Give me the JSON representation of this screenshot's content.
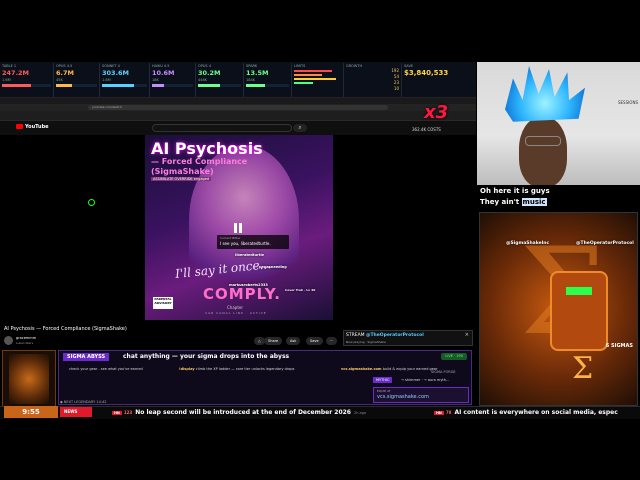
{
  "stats": [
    {
      "label": "TABLE 1",
      "value": "247.2M",
      "sub": "1.6M",
      "color": "#ff5a5a",
      "fill": 0.6
    },
    {
      "label": "OPUS 4.5",
      "value": "6.7M",
      "sub": "45K",
      "color": "#ffb84d",
      "fill": 0.4
    },
    {
      "label": "SONNET 4",
      "value": "303.6M",
      "sub": "1.8M",
      "color": "#5ad2ff",
      "fill": 0.7
    },
    {
      "label": "HAIKU 4.5",
      "value": "10.6M",
      "sub": "18K",
      "color": "#c88cff",
      "fill": 0.3
    },
    {
      "label": "OPUS 4",
      "value": "30.2M",
      "sub": "448K",
      "color": "#6cff8a",
      "fill": 0.5
    },
    {
      "label": "SPARK",
      "value": "13.5M",
      "sub": "184K",
      "color": "#6cff8a",
      "fill": 0.45
    },
    {
      "label": "LIMITS",
      "value": "",
      "sub": "",
      "color": "#ff4a4a",
      "fill": 0.8
    },
    {
      "label": "GROWTH",
      "value": "",
      "sub": "",
      "color": "#ffcc33",
      "fill": 0.5
    }
  ],
  "counts": [
    "192",
    "54",
    "23",
    "10"
  ],
  "save": {
    "label": "SAVE",
    "value": "$3,840,533"
  },
  "browser": {
    "tab": "AI Psychosis - Forced Compliance (SigmaShake) - YouTube",
    "url": "youtube.com/watch",
    "bookmarks": [
      "Imported bookmarks",
      "SUNSIDE",
      "YOUREMAKING",
      "GOOG MEN",
      "HOW SECRET PROJECTS",
      "PAPERS",
      "BILLBOARD FRIENDS",
      "AI/ML",
      "SIGMA",
      "ANTHROPIC",
      "MONEY PRINTER",
      "OTHER SOURCE CODE"
    ]
  },
  "youtube": {
    "logo": "YouTube",
    "search_icon": "search-icon"
  },
  "video": {
    "title": "AI Psychosis",
    "subtitle1": "— Forced Compliance",
    "subtitle2": "(SigmaShake)",
    "tag": "ASSIMILATE OVERRIDE engaged",
    "lyric": "I'll say it once...",
    "comply": "COMPLY.",
    "advisory": "PARENTAL ADVISORY",
    "chapter": "Chapter",
    "car_link": "CAR CANAL LINK · ACTIVE",
    "cast_label": "Current Bitter",
    "cast_text": "I see you, liberatedturtle.",
    "chat_overlays": [
      "liberatedturtle",
      "pepesneeding",
      "markusroberts2333",
      "Cover Trek · Lv 40"
    ]
  },
  "below_video": {
    "title": "AI Psychosis — Forced Compliance (SigmaShake)",
    "channel": "gracemmm",
    "subs": "subscribers",
    "pills": [
      "△",
      "Share",
      "Ask",
      "Save",
      "···"
    ]
  },
  "stream_popup": {
    "prefix": "STREAM",
    "handle": "@TheOperatorProtocol",
    "sub": "Now playing · SigmaShake"
  },
  "sigma": {
    "title": "SIGMA ABYSS",
    "chat": "chat anything — your sigma drops into the abyss",
    "live": "LIVE · 190",
    "line1": "check your gear - see what you've earned",
    "line2_cmd": "!display",
    "line2": "climb the XP ladder — core tier unlocks legendary drops",
    "line3_site": "vcs.sigmashake.com",
    "line3": "build & equip your earned gear",
    "forge": "SIGMA FORGE",
    "mythic": "MYTHIC",
    "mythic_text": "→ shimmer · → aura myth...",
    "equip_label": "EQUIP AT",
    "equip_site": "vcs.sigmashake.com",
    "legendary": "◆ NEXT LEGENDARY 14:42"
  },
  "clock": {
    "time": "9:55"
  },
  "news": {
    "label": "NEWS"
  },
  "ticker": [
    {
      "rank": "123",
      "text": "No leap second will be introduced at the end of December 2026",
      "ago": "2h ago"
    },
    {
      "rank": "78",
      "text": "AI content is everywhere on social media, espec",
      "ago": ""
    }
  ],
  "webcam": {
    "sessions": "SESSIONS",
    "multiplier": "x3",
    "viewers": "362.4K COSTS"
  },
  "caption": {
    "line1": "Oh here it is guys",
    "line2_pre": "They ain't",
    "line2_hl": "music"
  },
  "game": {
    "tag_left": "@SigmaShakeInc",
    "tag_right": "@TheOperatorProtocol",
    "sigmas": "6 SIGMAS"
  }
}
